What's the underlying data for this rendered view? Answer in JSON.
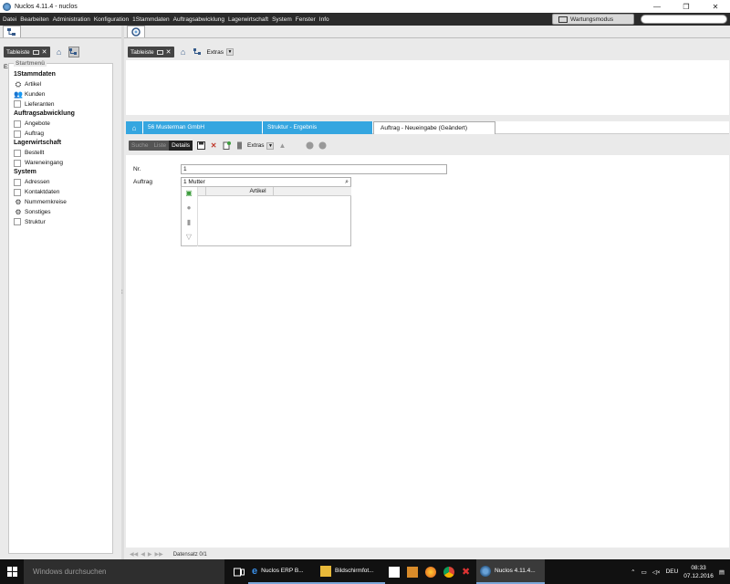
{
  "window": {
    "title": "Nuclos 4.11.4 - nuclos",
    "controls": [
      "—",
      "❐",
      "✕"
    ]
  },
  "menu": {
    "items": [
      "Datei",
      "Bearbeiten",
      "Administration",
      "Konfiguration",
      "1Stammdaten",
      "Auftragsabwicklung",
      "Lagerwirtschaft",
      "System",
      "Fenster",
      "Info"
    ],
    "maintenance_label": "Wartungsmodus"
  },
  "left_panel": {
    "table_btn": "Tableiste",
    "extras": "Extras",
    "start_legend": "Startmenü",
    "groups": [
      {
        "header": "1Stammdaten",
        "items": [
          {
            "label": "Artikel",
            "icon": "articles-icon"
          },
          {
            "label": "Kunden",
            "icon": "customers-icon"
          },
          {
            "label": "Lieferanten",
            "icon": "checkbox"
          }
        ]
      },
      {
        "header": "Auftragsabwicklung",
        "items": [
          {
            "label": "Angebote",
            "icon": "checkbox"
          },
          {
            "label": "Auftrag",
            "icon": "checkbox"
          }
        ]
      },
      {
        "header": "Lagerwirtschaft",
        "items": [
          {
            "label": "Bestellt",
            "icon": "checkbox"
          },
          {
            "label": "Wareneingang",
            "icon": "checkbox"
          }
        ]
      },
      {
        "header": "System",
        "items": [
          {
            "label": "Adressen",
            "icon": "checkbox"
          },
          {
            "label": "Kontaktdaten",
            "icon": "checkbox"
          },
          {
            "label": "Nummernkreise",
            "icon": "gear"
          },
          {
            "label": "Sonstiges",
            "icon": "gear"
          },
          {
            "label": "Struktur",
            "icon": "checkbox"
          }
        ]
      }
    ]
  },
  "right_panel": {
    "table_btn": "Tableiste",
    "extras": "Extras"
  },
  "breadcrumbs": {
    "crumb1": "56  Musterman GmbH",
    "crumb2": "Struktur - Ergebnis",
    "active": "Auftrag  - Neueingabe (Geändert)"
  },
  "detail_toolbar": {
    "seg_search": "Suche",
    "seg_list": "Liste",
    "seg_details": "Details",
    "extras": "Extras"
  },
  "form": {
    "nr_label": "Nr.",
    "nr_value": "1",
    "auftrag_label": "Auftrag",
    "auftrag_value": "1  Mutter",
    "subgrid_col": "Artikel"
  },
  "status": {
    "record": "Datensatz 0/1"
  },
  "taskbar": {
    "search_placeholder": "Windows durchsuchen",
    "app1": "Nuclos ERP B...",
    "app2": "Bildschirmfot...",
    "app3": "Nuclos 4.11.4...",
    "lang": "DEU",
    "time": "08:33",
    "date": "07.12.2016"
  },
  "colors": {
    "accent_blue": "#35a6e0",
    "menubar": "#2b2b2b"
  }
}
